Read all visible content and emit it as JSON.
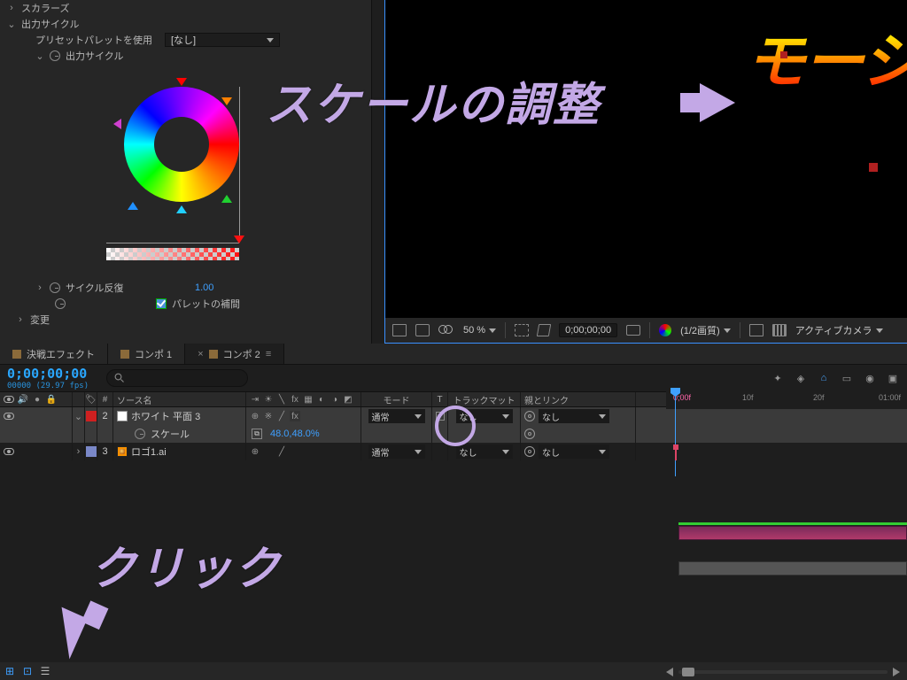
{
  "fx": {
    "group0_label": "スカラーズ",
    "group_output_cycle": "出力サイクル",
    "preset_palette_label": "プリセットパレットを使用",
    "preset_palette_value": "[なし]",
    "output_cycle_sub": "出力サイクル",
    "cycle_repeat_label": "サイクル反復",
    "cycle_repeat_value": "1.00",
    "palette_interp_label": "パレットの補間",
    "change_label": "変更"
  },
  "viewer": {
    "zoom": "50 %",
    "timecode": "0;00;00;00",
    "quality": "(1/2画質)",
    "camera": "アクティブカメラ",
    "mo_text": "モーシ"
  },
  "tabs": [
    {
      "label": "決戦エフェクト",
      "active": false
    },
    {
      "label": "コンポ 1",
      "active": false
    },
    {
      "label": "コンポ 2",
      "active": true
    }
  ],
  "timeline": {
    "timecode": "0;00;00;00",
    "fps_line": "00000 (29.97 fps)",
    "search_placeholder": "",
    "ruler": {
      "t0": "0;00f",
      "t1": "10f",
      "t2": "20f",
      "t3": "01:00f"
    },
    "col": {
      "num": "#",
      "source_name": "ソース名",
      "mode": "モード",
      "trackmatte_t": "T",
      "trackmatte": "トラックマット",
      "parent": "親とリンク"
    },
    "layers": [
      {
        "num": "2",
        "color": "#d02020",
        "swatch": "#ffffff",
        "name": "ホワイト 平面 3",
        "mode": "通常",
        "tmat": "なし",
        "parent": "なし",
        "selected": true
      },
      {
        "prop_label": "スケール",
        "prop_value": "48.0,48.0%"
      },
      {
        "num": "3",
        "color": "#7a88c8",
        "swatch_icon": "ai",
        "name": "ロゴ1.ai",
        "mode": "通常",
        "tmat": "なし",
        "parent": "なし",
        "selected": false
      }
    ]
  },
  "anno": {
    "scale": "スケールの調整",
    "click": "クリック"
  }
}
